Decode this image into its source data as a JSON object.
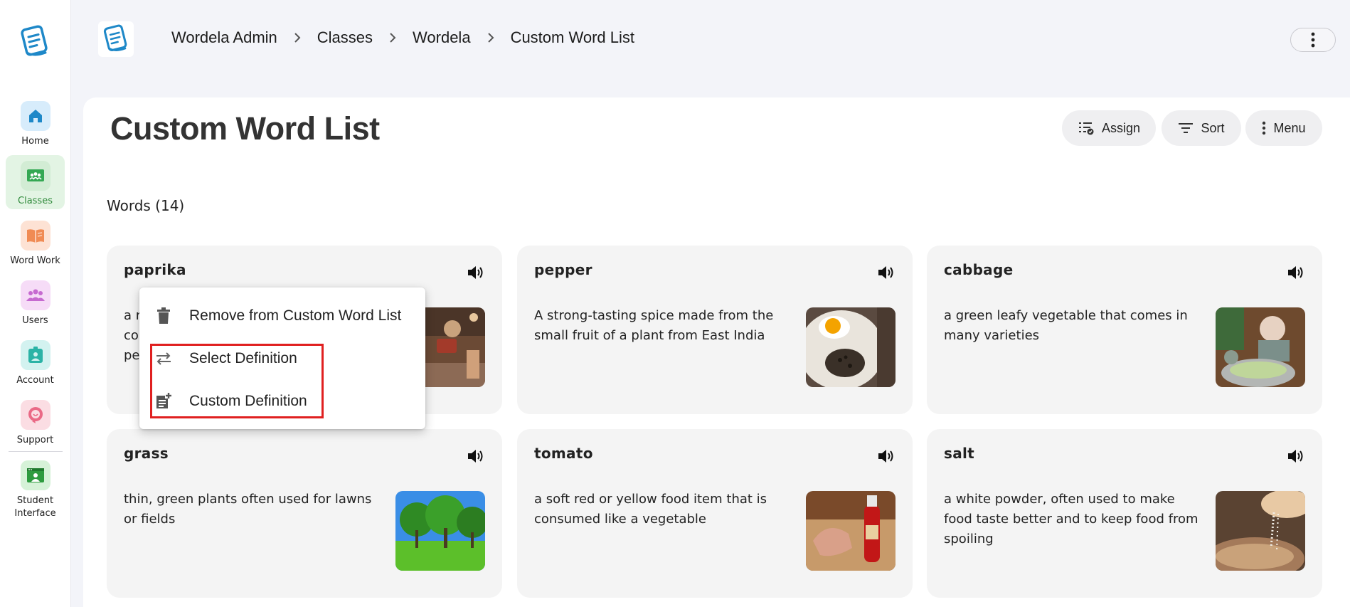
{
  "sidebar": {
    "items": [
      {
        "label": "Home",
        "icon": "home-icon"
      },
      {
        "label": "Classes",
        "icon": "classes-icon"
      },
      {
        "label": "Word Work",
        "icon": "book-icon"
      },
      {
        "label": "Users",
        "icon": "users-icon"
      },
      {
        "label": "Account",
        "icon": "account-icon"
      },
      {
        "label": "Support",
        "icon": "support-icon"
      },
      {
        "label": "Student Interface",
        "icon": "student-interface-icon"
      }
    ]
  },
  "breadcrumb": [
    "Wordela Admin",
    "Classes",
    "Wordela",
    "Custom Word List"
  ],
  "page": {
    "title": "Custom Word List",
    "words_heading": "Words (14)",
    "actions": {
      "assign": "Assign",
      "sort": "Sort",
      "menu": "Menu"
    }
  },
  "cards": [
    {
      "word": "paprika",
      "definition": "a r co pe"
    },
    {
      "word": "pepper",
      "definition": "A strong-tasting spice made from the small fruit of a plant from East India"
    },
    {
      "word": "cabbage",
      "definition": "a green leafy vegetable that comes in many varieties"
    },
    {
      "word": "grass",
      "definition": "thin, green plants often used for lawns or fields"
    },
    {
      "word": "tomato",
      "definition": "a soft red or yellow food item that is consumed like a vegetable"
    },
    {
      "word": "salt",
      "definition": "a white powder, often used to make food taste better and to keep food from spoiling"
    }
  ],
  "context_menu": {
    "remove": "Remove from Custom Word List",
    "select": "Select Definition",
    "custom": "Custom Definition"
  },
  "colors": {
    "accent_blue": "#1e88c8",
    "active_green": "#2f8a3a",
    "highlight_red": "#e02020"
  }
}
